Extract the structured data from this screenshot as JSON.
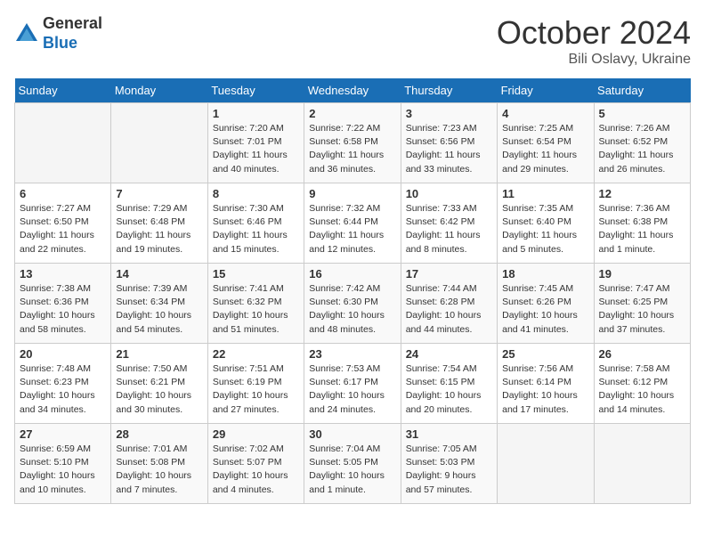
{
  "header": {
    "logo_general": "General",
    "logo_blue": "Blue",
    "month_title": "October 2024",
    "location": "Bili Oslavy, Ukraine"
  },
  "weekdays": [
    "Sunday",
    "Monday",
    "Tuesday",
    "Wednesday",
    "Thursday",
    "Friday",
    "Saturday"
  ],
  "weeks": [
    [
      {
        "day": "",
        "info": ""
      },
      {
        "day": "",
        "info": ""
      },
      {
        "day": "1",
        "info": "Sunrise: 7:20 AM\nSunset: 7:01 PM\nDaylight: 11 hours\nand 40 minutes."
      },
      {
        "day": "2",
        "info": "Sunrise: 7:22 AM\nSunset: 6:58 PM\nDaylight: 11 hours\nand 36 minutes."
      },
      {
        "day": "3",
        "info": "Sunrise: 7:23 AM\nSunset: 6:56 PM\nDaylight: 11 hours\nand 33 minutes."
      },
      {
        "day": "4",
        "info": "Sunrise: 7:25 AM\nSunset: 6:54 PM\nDaylight: 11 hours\nand 29 minutes."
      },
      {
        "day": "5",
        "info": "Sunrise: 7:26 AM\nSunset: 6:52 PM\nDaylight: 11 hours\nand 26 minutes."
      }
    ],
    [
      {
        "day": "6",
        "info": "Sunrise: 7:27 AM\nSunset: 6:50 PM\nDaylight: 11 hours\nand 22 minutes."
      },
      {
        "day": "7",
        "info": "Sunrise: 7:29 AM\nSunset: 6:48 PM\nDaylight: 11 hours\nand 19 minutes."
      },
      {
        "day": "8",
        "info": "Sunrise: 7:30 AM\nSunset: 6:46 PM\nDaylight: 11 hours\nand 15 minutes."
      },
      {
        "day": "9",
        "info": "Sunrise: 7:32 AM\nSunset: 6:44 PM\nDaylight: 11 hours\nand 12 minutes."
      },
      {
        "day": "10",
        "info": "Sunrise: 7:33 AM\nSunset: 6:42 PM\nDaylight: 11 hours\nand 8 minutes."
      },
      {
        "day": "11",
        "info": "Sunrise: 7:35 AM\nSunset: 6:40 PM\nDaylight: 11 hours\nand 5 minutes."
      },
      {
        "day": "12",
        "info": "Sunrise: 7:36 AM\nSunset: 6:38 PM\nDaylight: 11 hours\nand 1 minute."
      }
    ],
    [
      {
        "day": "13",
        "info": "Sunrise: 7:38 AM\nSunset: 6:36 PM\nDaylight: 10 hours\nand 58 minutes."
      },
      {
        "day": "14",
        "info": "Sunrise: 7:39 AM\nSunset: 6:34 PM\nDaylight: 10 hours\nand 54 minutes."
      },
      {
        "day": "15",
        "info": "Sunrise: 7:41 AM\nSunset: 6:32 PM\nDaylight: 10 hours\nand 51 minutes."
      },
      {
        "day": "16",
        "info": "Sunrise: 7:42 AM\nSunset: 6:30 PM\nDaylight: 10 hours\nand 48 minutes."
      },
      {
        "day": "17",
        "info": "Sunrise: 7:44 AM\nSunset: 6:28 PM\nDaylight: 10 hours\nand 44 minutes."
      },
      {
        "day": "18",
        "info": "Sunrise: 7:45 AM\nSunset: 6:26 PM\nDaylight: 10 hours\nand 41 minutes."
      },
      {
        "day": "19",
        "info": "Sunrise: 7:47 AM\nSunset: 6:25 PM\nDaylight: 10 hours\nand 37 minutes."
      }
    ],
    [
      {
        "day": "20",
        "info": "Sunrise: 7:48 AM\nSunset: 6:23 PM\nDaylight: 10 hours\nand 34 minutes."
      },
      {
        "day": "21",
        "info": "Sunrise: 7:50 AM\nSunset: 6:21 PM\nDaylight: 10 hours\nand 30 minutes."
      },
      {
        "day": "22",
        "info": "Sunrise: 7:51 AM\nSunset: 6:19 PM\nDaylight: 10 hours\nand 27 minutes."
      },
      {
        "day": "23",
        "info": "Sunrise: 7:53 AM\nSunset: 6:17 PM\nDaylight: 10 hours\nand 24 minutes."
      },
      {
        "day": "24",
        "info": "Sunrise: 7:54 AM\nSunset: 6:15 PM\nDaylight: 10 hours\nand 20 minutes."
      },
      {
        "day": "25",
        "info": "Sunrise: 7:56 AM\nSunset: 6:14 PM\nDaylight: 10 hours\nand 17 minutes."
      },
      {
        "day": "26",
        "info": "Sunrise: 7:58 AM\nSunset: 6:12 PM\nDaylight: 10 hours\nand 14 minutes."
      }
    ],
    [
      {
        "day": "27",
        "info": "Sunrise: 6:59 AM\nSunset: 5:10 PM\nDaylight: 10 hours\nand 10 minutes."
      },
      {
        "day": "28",
        "info": "Sunrise: 7:01 AM\nSunset: 5:08 PM\nDaylight: 10 hours\nand 7 minutes."
      },
      {
        "day": "29",
        "info": "Sunrise: 7:02 AM\nSunset: 5:07 PM\nDaylight: 10 hours\nand 4 minutes."
      },
      {
        "day": "30",
        "info": "Sunrise: 7:04 AM\nSunset: 5:05 PM\nDaylight: 10 hours\nand 1 minute."
      },
      {
        "day": "31",
        "info": "Sunrise: 7:05 AM\nSunset: 5:03 PM\nDaylight: 9 hours\nand 57 minutes."
      },
      {
        "day": "",
        "info": ""
      },
      {
        "day": "",
        "info": ""
      }
    ]
  ]
}
